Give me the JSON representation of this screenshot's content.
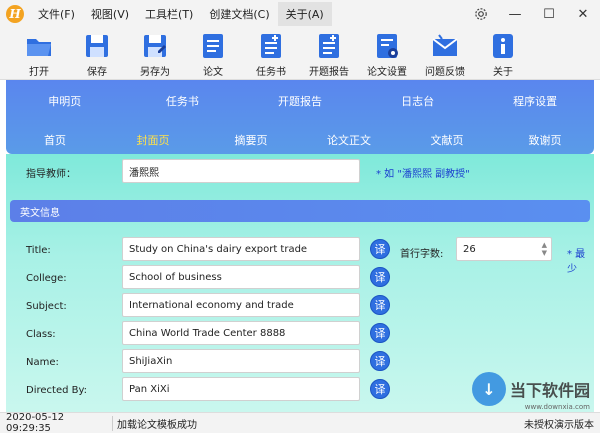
{
  "menubar": {
    "logo": "H",
    "items": [
      "文件(F)",
      "视图(V)",
      "工具栏(T)",
      "创建文档(C)",
      "关于(A)"
    ],
    "settings_icon": "gear-icon",
    "controls": [
      "—",
      "☐",
      "✕"
    ]
  },
  "toolbar": {
    "tools": [
      {
        "label": "打开",
        "icon": "folder-icon"
      },
      {
        "label": "保存",
        "icon": "save-icon"
      },
      {
        "label": "另存为",
        "icon": "save-as-icon"
      },
      {
        "label": "论文",
        "icon": "paper-doc-icon"
      },
      {
        "label": "任务书",
        "icon": "task-doc-icon"
      },
      {
        "label": "开题报告",
        "icon": "proposal-doc-icon"
      },
      {
        "label": "论文设置",
        "icon": "doc-settings-icon"
      },
      {
        "label": "问题反馈",
        "icon": "mail-icon"
      },
      {
        "label": "关于",
        "icon": "info-icon"
      }
    ]
  },
  "tabs": {
    "row1": [
      "申明页",
      "任务书",
      "开题报告",
      "日志台",
      "程序设置"
    ],
    "row2": [
      "首页",
      "封面页",
      "摘要页",
      "论文正文",
      "文献页",
      "致谢页"
    ],
    "active": "封面页"
  },
  "form": {
    "advisor_label": "指导教师：",
    "advisor_value": "潘熙熙",
    "advisor_hint": "* 如 \"潘熙熙   副教授\"",
    "section_title": "英文信息",
    "fields": [
      {
        "label": "Title:",
        "value": "Study on China's dairy export trade"
      },
      {
        "label": "College:",
        "value": "School of business"
      },
      {
        "label": "Subject:",
        "value": "International economy and trade"
      },
      {
        "label": "Class:",
        "value": "China World Trade Center 8888"
      },
      {
        "label": "Name:",
        "value": "ShiJiaXin"
      },
      {
        "label": "Directed By:",
        "value": "Pan XiXi"
      }
    ],
    "translate_label": "译",
    "line_chars_label": "首行字数:",
    "line_chars_value": "26",
    "right_hint": "* 最少"
  },
  "statusbar": {
    "time": "2020-05-12 09:29:35",
    "message": "加载论文模板成功",
    "right": "未授权演示版本"
  },
  "watermark": {
    "text": "当下软件园",
    "sub": "www.downxia.com",
    "logo_char": "↓"
  },
  "colors": {
    "tab_gradient": "#5a86ee",
    "content_bg": "#7fe9da",
    "active_tab": "#ffe14a",
    "hint": "#1a3ecf",
    "translate_btn": "#2f6fe0"
  }
}
